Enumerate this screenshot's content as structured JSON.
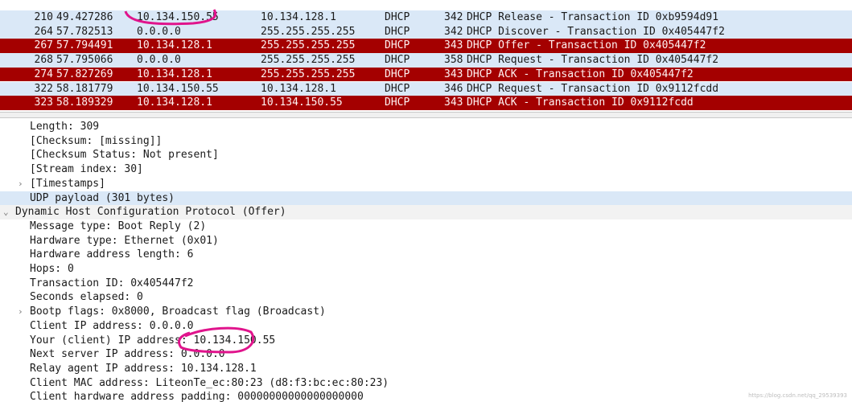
{
  "packets": [
    {
      "no": "210",
      "time": "49.427286",
      "src": "10.134.150.55",
      "dst": "10.134.128.1",
      "proto": "DHCP",
      "len": "342",
      "info": "DHCP Release  - Transaction ID 0xb9594d91",
      "style": "top"
    },
    {
      "no": "264",
      "time": "57.782513",
      "src": "0.0.0.0",
      "dst": "255.255.255.255",
      "proto": "DHCP",
      "len": "342",
      "info": "DHCP Discover - Transaction ID 0x405447f2",
      "style": "blue"
    },
    {
      "no": "267",
      "time": "57.794491",
      "src": "10.134.128.1",
      "dst": "255.255.255.255",
      "proto": "DHCP",
      "len": "343",
      "info": "DHCP Offer    - Transaction ID 0x405447f2",
      "style": "red"
    },
    {
      "no": "268",
      "time": "57.795066",
      "src": "0.0.0.0",
      "dst": "255.255.255.255",
      "proto": "DHCP",
      "len": "358",
      "info": "DHCP Request  - Transaction ID 0x405447f2",
      "style": "blue"
    },
    {
      "no": "274",
      "time": "57.827269",
      "src": "10.134.128.1",
      "dst": "255.255.255.255",
      "proto": "DHCP",
      "len": "343",
      "info": "DHCP ACK      - Transaction ID 0x405447f2",
      "style": "red"
    },
    {
      "no": "322",
      "time": "58.181779",
      "src": "10.134.150.55",
      "dst": "10.134.128.1",
      "proto": "DHCP",
      "len": "346",
      "info": "DHCP Request  - Transaction ID 0x9112fcdd",
      "style": "blue"
    },
    {
      "no": "323",
      "time": "58.189329",
      "src": "10.134.128.1",
      "dst": "10.134.150.55",
      "proto": "DHCP",
      "len": "343",
      "info": "DHCP ACK      - Transaction ID 0x9112fcdd",
      "style": "red"
    }
  ],
  "details": [
    {
      "text": "Length: 309",
      "indent": 1,
      "expander": "",
      "style": ""
    },
    {
      "text": "[Checksum: [missing]]",
      "indent": 1,
      "expander": "",
      "style": ""
    },
    {
      "text": "[Checksum Status: Not present]",
      "indent": 1,
      "expander": "",
      "style": ""
    },
    {
      "text": "[Stream index: 30]",
      "indent": 1,
      "expander": "",
      "style": ""
    },
    {
      "text": "[Timestamps]",
      "indent": 1,
      "expander": "›",
      "style": ""
    },
    {
      "text": "UDP payload (301 bytes)",
      "indent": 1,
      "expander": "",
      "style": "hl"
    },
    {
      "text": "Dynamic Host Configuration Protocol (Offer)",
      "indent": 0,
      "expander": "⌄",
      "style": "section"
    },
    {
      "text": "Message type: Boot Reply (2)",
      "indent": 1,
      "expander": "",
      "style": ""
    },
    {
      "text": "Hardware type: Ethernet (0x01)",
      "indent": 1,
      "expander": "",
      "style": ""
    },
    {
      "text": "Hardware address length: 6",
      "indent": 1,
      "expander": "",
      "style": ""
    },
    {
      "text": "Hops: 0",
      "indent": 1,
      "expander": "",
      "style": ""
    },
    {
      "text": "Transaction ID: 0x405447f2",
      "indent": 1,
      "expander": "",
      "style": ""
    },
    {
      "text": "Seconds elapsed: 0",
      "indent": 1,
      "expander": "",
      "style": ""
    },
    {
      "text": "Bootp flags: 0x8000, Broadcast flag (Broadcast)",
      "indent": 1,
      "expander": "›",
      "style": ""
    },
    {
      "text": "Client IP address: 0.0.0.0",
      "indent": 1,
      "expander": "",
      "style": ""
    },
    {
      "text": "Your (client) IP address: 10.134.150.55",
      "indent": 1,
      "expander": "",
      "style": ""
    },
    {
      "text": "Next server IP address: 0.0.0.0",
      "indent": 1,
      "expander": "",
      "style": ""
    },
    {
      "text": "Relay agent IP address: 10.134.128.1",
      "indent": 1,
      "expander": "",
      "style": ""
    },
    {
      "text": "Client MAC address: LiteonTe_ec:80:23 (d8:f3:bc:ec:80:23)",
      "indent": 1,
      "expander": "",
      "style": ""
    },
    {
      "text": "Client hardware address padding: 00000000000000000000",
      "indent": 1,
      "expander": "",
      "style": ""
    }
  ],
  "colors": {
    "selected_red": "#a40000",
    "row_blue": "#dae8f7",
    "annotation_magenta": "#e0148c"
  },
  "watermark": "https://blog.csdn.net/qq_29539393"
}
